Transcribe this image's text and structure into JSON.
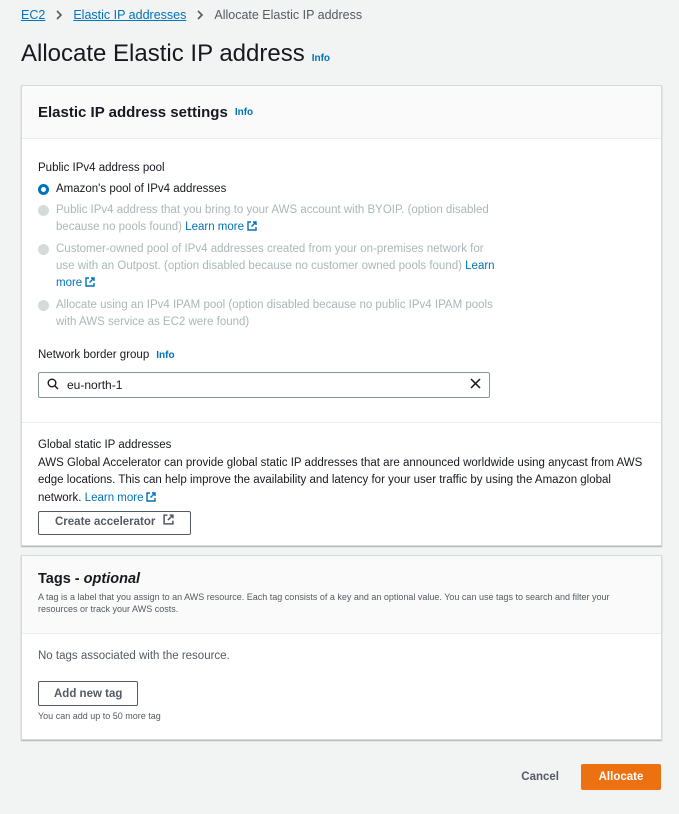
{
  "breadcrumb": {
    "items": [
      "EC2",
      "Elastic IP addresses"
    ],
    "current": "Allocate Elastic IP address"
  },
  "page": {
    "title": "Allocate Elastic IP address",
    "info": "Info"
  },
  "settings": {
    "title": "Elastic IP address settings",
    "info": "Info",
    "pool_label": "Public IPv4 address pool",
    "options": [
      {
        "text": "Amazon's pool of IPv4 addresses",
        "selected": true
      },
      {
        "text": "Public IPv4 address that you bring to your AWS account with BYOIP. (option disabled because no pools found)",
        "link": "Learn more"
      },
      {
        "text": "Customer-owned pool of IPv4 addresses created from your on-premises network for use with an Outpost. (option disabled because no customer owned pools found)",
        "link": "Learn more"
      },
      {
        "text": "Allocate using an IPv4 IPAM pool (option disabled because no public IPv4 IPAM pools with AWS service as EC2 were found)"
      }
    ],
    "border_group_label": "Network border group",
    "border_group_info": "Info",
    "border_group_value": "eu-north-1"
  },
  "global_static": {
    "title": "Global static IP addresses",
    "description": "AWS Global Accelerator can provide global static IP addresses that are announced worldwide using anycast from AWS edge locations. This can help improve the availability and latency for your user traffic by using the Amazon global network.",
    "link": "Learn more",
    "button": "Create accelerator"
  },
  "tags": {
    "title": "Tags - ",
    "title_optional": "optional",
    "description": "A tag is a label that you assign to an AWS resource. Each tag consists of a key and an optional value. You can use tags to search and filter your resources or track your AWS costs.",
    "empty": "No tags associated with the resource.",
    "add_button": "Add new tag",
    "limit": "You can add up to 50 more tag"
  },
  "actions": {
    "cancel": "Cancel",
    "allocate": "Allocate"
  },
  "colors": {
    "link": "#0073bb",
    "primary": "#ec7211"
  }
}
